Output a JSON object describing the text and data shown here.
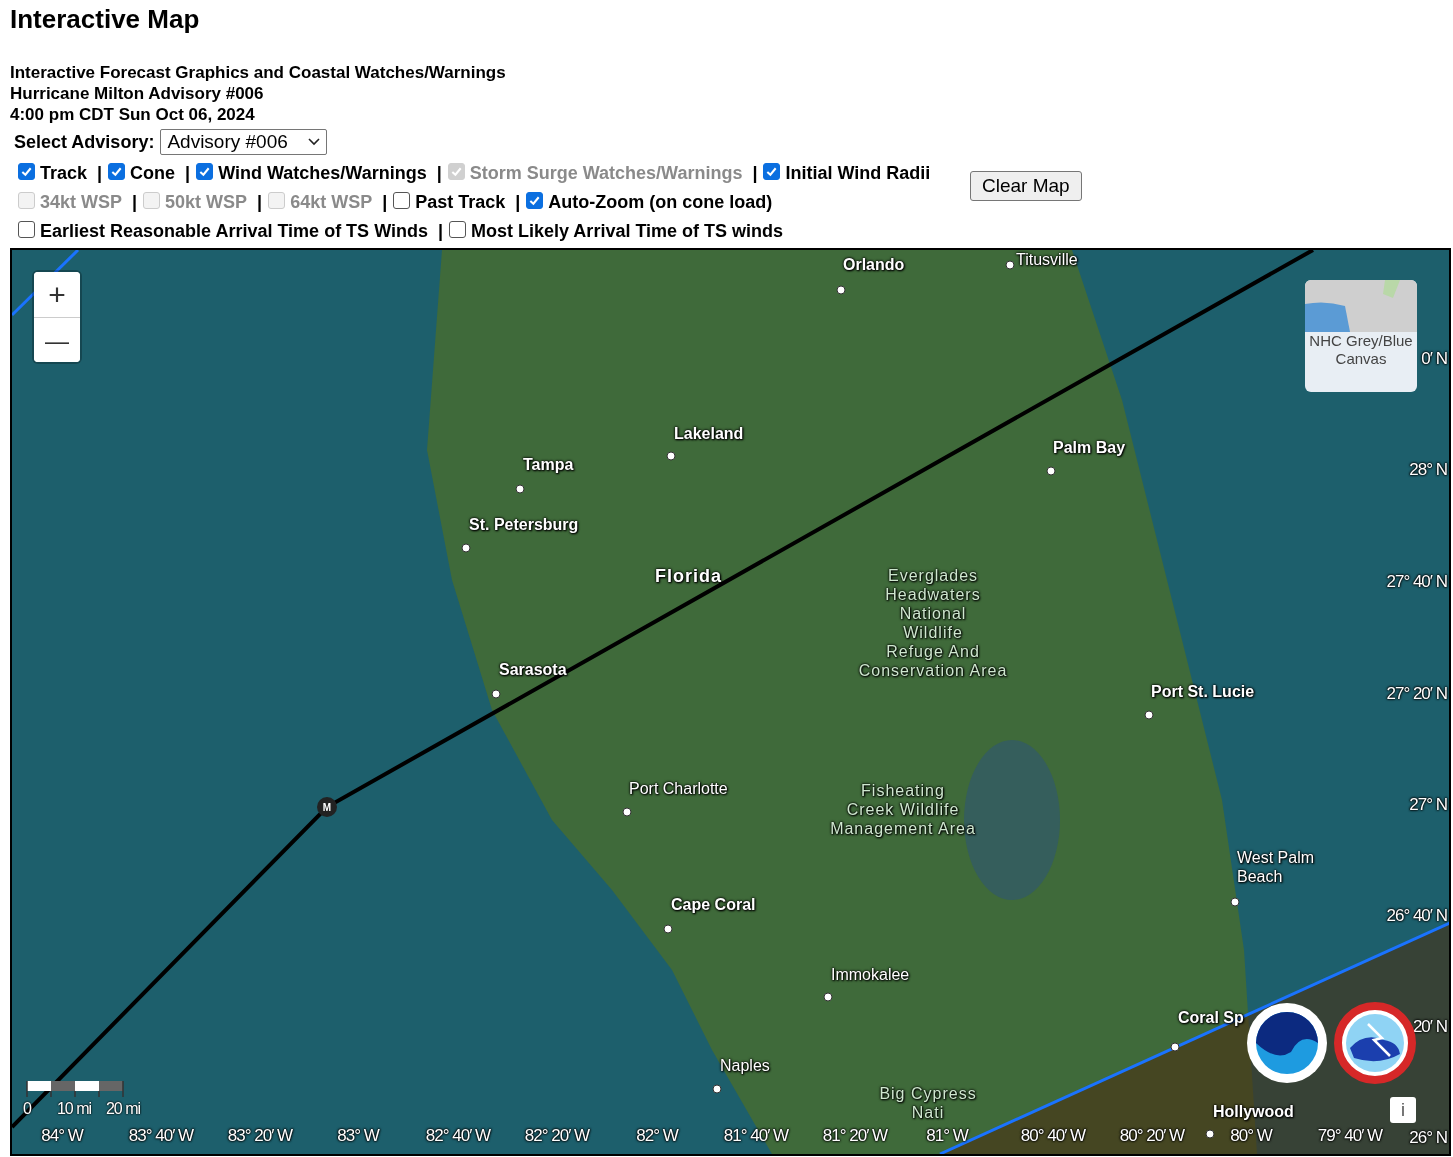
{
  "page": {
    "title": "Interactive Map",
    "subtitle_lines": [
      "Interactive Forecast Graphics and Coastal Watches/Warnings",
      "Hurricane Milton Advisory #006",
      "4:00 pm CDT Sun Oct 06, 2024"
    ]
  },
  "advisory_select": {
    "label": "Select Advisory:",
    "value": "Advisory #006"
  },
  "layer_rows": [
    [
      {
        "label": "Track",
        "checked": true,
        "disabled": false,
        "separator": "|"
      },
      {
        "label": "Cone",
        "checked": true,
        "disabled": false,
        "separator": "|"
      },
      {
        "label": "Wind Watches/Warnings",
        "checked": true,
        "disabled": false,
        "separator": "|"
      },
      {
        "label": "Storm Surge Watches/Warnings",
        "checked": true,
        "disabled": true,
        "separator": "|"
      },
      {
        "label": "Initial Wind Radii",
        "checked": true,
        "disabled": false
      }
    ],
    [
      {
        "label": "34kt WSP",
        "checked": false,
        "disabled": true,
        "separator": "|"
      },
      {
        "label": "50kt WSP",
        "checked": false,
        "disabled": true,
        "separator": "|"
      },
      {
        "label": "64kt WSP",
        "checked": false,
        "disabled": true,
        "separator": "|"
      },
      {
        "label": "Past Track",
        "checked": false,
        "disabled": false,
        "separator": "|"
      },
      {
        "label": "Auto-Zoom (on cone load)",
        "checked": true,
        "disabled": false
      }
    ],
    [
      {
        "label": "Earliest Reasonable Arrival Time of TS Winds",
        "checked": false,
        "disabled": false,
        "separator": "|"
      },
      {
        "label": "Most Likely Arrival Time of TS winds",
        "checked": false,
        "disabled": false
      }
    ]
  ],
  "clear_button": "Clear Map",
  "map": {
    "zoom_in": "+",
    "zoom_out": "—",
    "basemap_label": "NHC Grey/Blue Canvas",
    "storm_marker": "M",
    "info_button": "i",
    "scale_labels": [
      "0",
      "10 mi",
      "20 mi"
    ],
    "places": [
      {
        "lines": [
          "Titusville"
        ],
        "kind": "minor"
      },
      {
        "lines": [
          "Orlando"
        ],
        "kind": "major"
      },
      {
        "lines": [
          "Lakeland"
        ],
        "kind": "major"
      },
      {
        "lines": [
          "Palm Bay"
        ],
        "kind": "major"
      },
      {
        "lines": [
          "Tampa"
        ],
        "kind": "major"
      },
      {
        "lines": [
          "St. Petersburg"
        ],
        "kind": "major"
      },
      {
        "lines": [
          "Florida"
        ],
        "kind": "region"
      },
      {
        "lines": [
          "Sarasota"
        ],
        "kind": "major"
      },
      {
        "lines": [
          "Everglades",
          "Headwaters",
          "National",
          "Wildlife",
          "Refuge And",
          "Conservation Area"
        ],
        "kind": "area"
      },
      {
        "lines": [
          "Port St. Lucie"
        ],
        "kind": "major"
      },
      {
        "lines": [
          "Port Charlotte"
        ],
        "kind": "minor"
      },
      {
        "lines": [
          "Fisheating",
          "Creek Wildlife",
          "Management Area"
        ],
        "kind": "area"
      },
      {
        "lines": [
          "West Palm",
          "Beach"
        ],
        "kind": "minor"
      },
      {
        "lines": [
          "Cape Coral"
        ],
        "kind": "major"
      },
      {
        "lines": [
          "Immokalee"
        ],
        "kind": "minor"
      },
      {
        "lines": [
          "Coral Sp"
        ],
        "kind": "major"
      },
      {
        "lines": [
          "Naples"
        ],
        "kind": "minor"
      },
      {
        "lines": [
          "Big Cypress",
          "Nati"
        ],
        "kind": "area"
      },
      {
        "lines": [
          "Hollywood"
        ],
        "kind": "major"
      }
    ],
    "longitude_labels": [
      "84° W",
      "83° 40′ W",
      "83° 20′ W",
      "83° W",
      "82° 40′ W",
      "82° 20′ W",
      "82° W",
      "81° 40′ W",
      "81° 20′ W",
      "81° W",
      "80° 40′ W",
      "80° 20′ W",
      "80° W",
      "79° 40′ W"
    ],
    "latitude_labels": [
      "0′ N",
      "28° N",
      "27° 40′ N",
      "27° 20′ N",
      "27° N",
      "26° 40′ N",
      "20′ N",
      "26° N"
    ]
  }
}
